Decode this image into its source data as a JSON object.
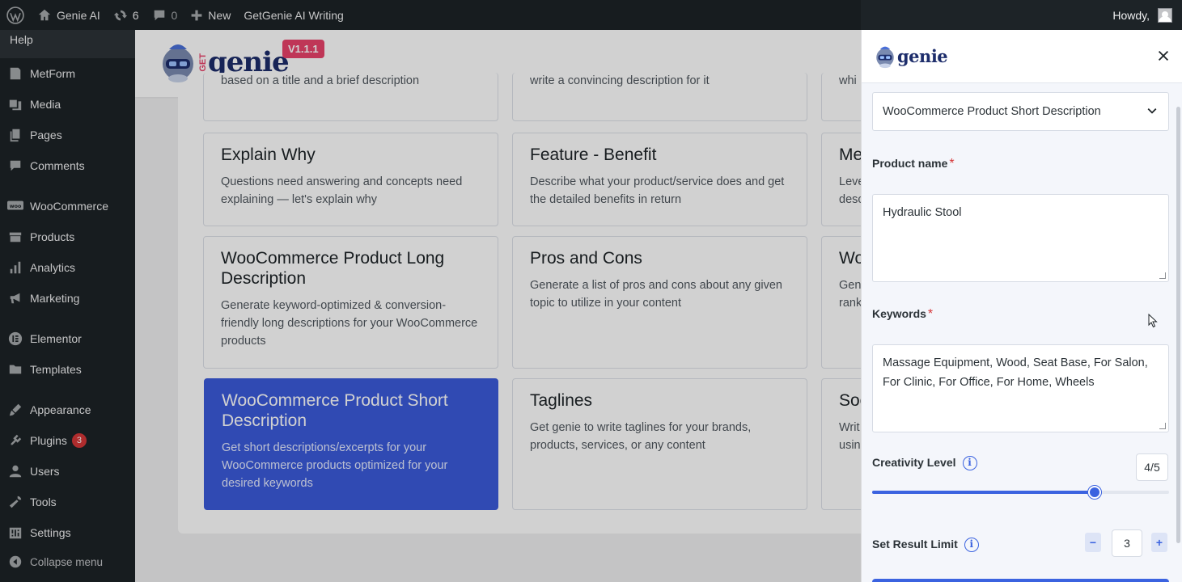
{
  "adminbar": {
    "site_name": "Genie AI",
    "updates_count": "6",
    "comments_count": "0",
    "new_label": "New",
    "plugin_link": "GetGenie AI Writing",
    "howdy": "Howdy,"
  },
  "sidebar": {
    "help": "Help",
    "items": [
      {
        "label": "MetForm",
        "icon": "metform-icon"
      },
      {
        "label": "Media",
        "icon": "media-icon"
      },
      {
        "label": "Pages",
        "icon": "pages-icon"
      },
      {
        "label": "Comments",
        "icon": "comments-icon"
      },
      {
        "label": "WooCommerce",
        "icon": "woocommerce-icon"
      },
      {
        "label": "Products",
        "icon": "products-icon"
      },
      {
        "label": "Analytics",
        "icon": "analytics-icon"
      },
      {
        "label": "Marketing",
        "icon": "marketing-icon"
      },
      {
        "label": "Elementor",
        "icon": "elementor-icon"
      },
      {
        "label": "Templates",
        "icon": "templates-icon"
      },
      {
        "label": "Appearance",
        "icon": "appearance-icon"
      },
      {
        "label": "Plugins",
        "icon": "plugins-icon",
        "badge": "3"
      },
      {
        "label": "Users",
        "icon": "users-icon"
      },
      {
        "label": "Tools",
        "icon": "tools-icon"
      },
      {
        "label": "Settings",
        "icon": "settings-icon"
      },
      {
        "label": "Collapse menu",
        "icon": "collapse-icon"
      }
    ]
  },
  "main": {
    "logo_text": "genie",
    "logo_prefix": "GET",
    "version": "V1.1.1",
    "cards_top_desc": [
      "based on a title and a brief description",
      "write a convincing description for it",
      "whi"
    ],
    "cards": [
      {
        "title": "Explain Why",
        "desc": "Questions need answering and concepts need explaining — let's explain why"
      },
      {
        "title": "Feature - Benefit",
        "desc": "Describe what your product/service does and get the detailed benefits in return"
      },
      {
        "title": "Me",
        "desc": "Leve desc"
      },
      {
        "title": "WooCommerce Product Long Description",
        "desc": "Generate keyword-optimized & conversion-friendly long descriptions for your WooCommerce products"
      },
      {
        "title": "Pros and Cons",
        "desc": "Generate a list of pros and cons about any given topic to utilize in your content"
      },
      {
        "title": "Wo",
        "desc": "Gen rank"
      },
      {
        "title": "WooCommerce Product Short Description",
        "desc": "Get short descriptions/excerpts for your WooCommerce products optimized for your desired keywords"
      },
      {
        "title": "Taglines",
        "desc": "Get genie to write taglines for your brands, products, services, or any content"
      },
      {
        "title": "Soc",
        "desc": "Writ usin"
      }
    ]
  },
  "panel": {
    "logo_text": "genie",
    "template_select": "WooCommerce Product Short Description",
    "product_name_label": "Product name",
    "product_name_value": "Hydraulic Stool",
    "keywords_label": "Keywords",
    "keywords_value": "Massage Equipment, Wood, Seat Base, For Salon, For Clinic, For Office, For Home, Wheels",
    "required_mark": "*",
    "creativity_label": "Creativity Level",
    "creativity_value": "4/5",
    "creativity_level": 0.75,
    "result_limit_label": "Set Result Limit",
    "result_limit_value": "3",
    "minus": "−",
    "plus": "+"
  },
  "colors": {
    "admin_dark": "#1d2327",
    "accent_blue": "#3b63e0",
    "active_card": "#3b5bdb",
    "version_badge": "#e9436b",
    "badge_red": "#d63638"
  }
}
